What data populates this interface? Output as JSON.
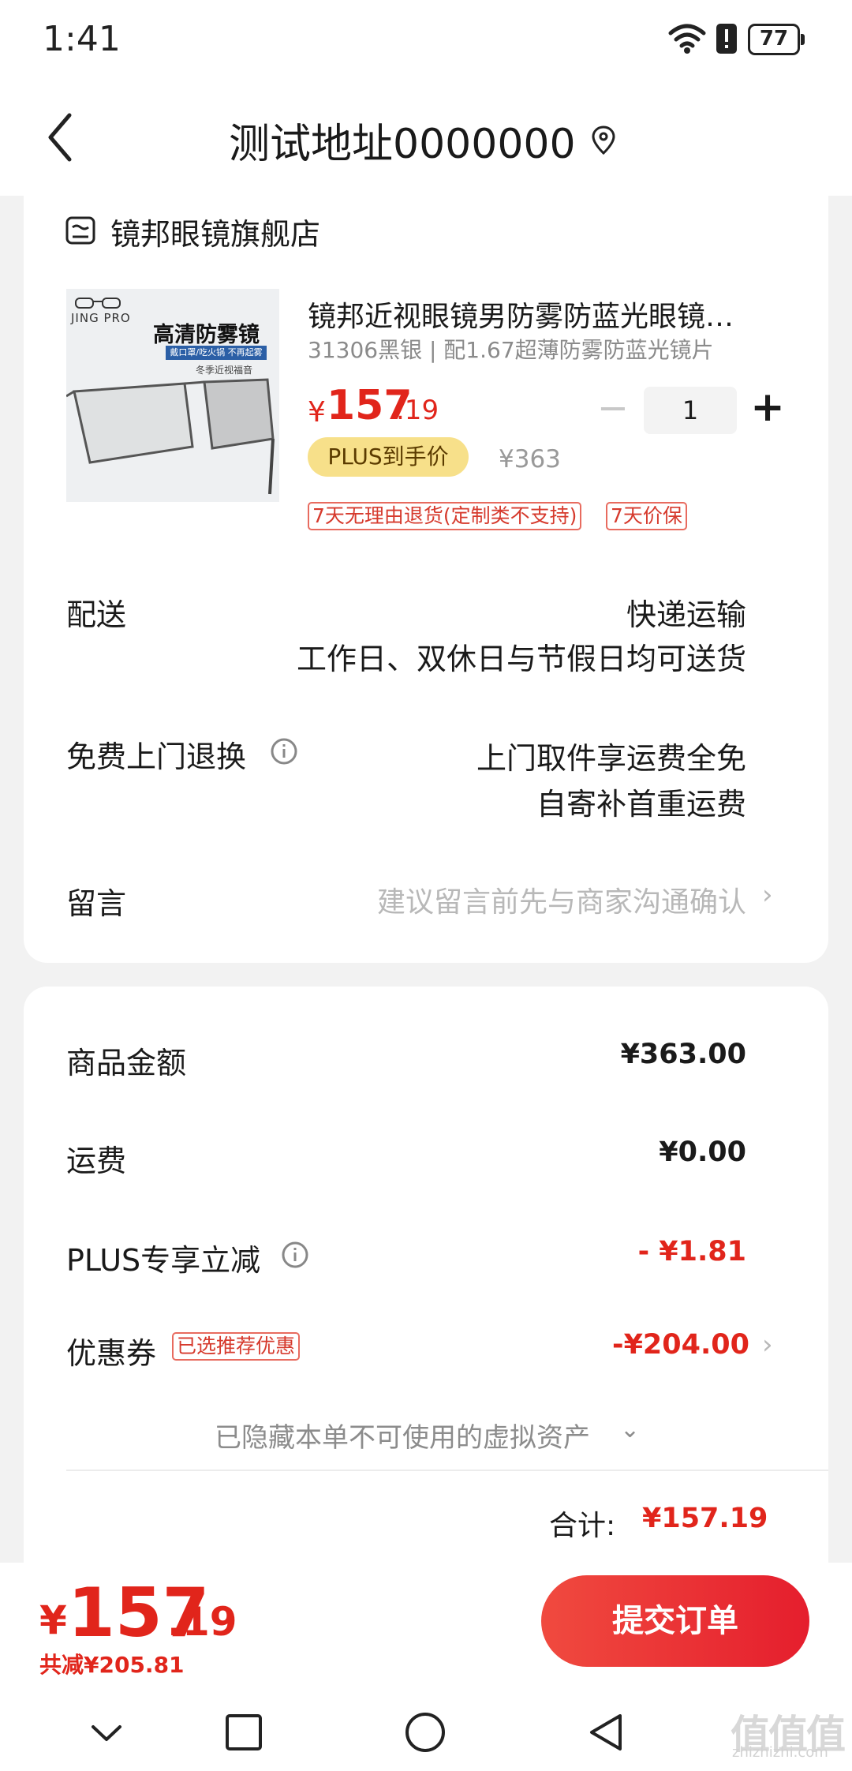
{
  "status_bar": {
    "time": "1:41",
    "battery": "77"
  },
  "header": {
    "title": "测试地址0000000"
  },
  "store": {
    "name": "镜邦眼镜旗舰店"
  },
  "product": {
    "image_text": {
      "brand": "JING PRO",
      "headline": "高清防雾镜",
      "tagbar": "戴口罩/吃火锅 不再起雾",
      "sub": "冬季近视福音"
    },
    "title": "镜邦近视眼镜男防雾防蓝光眼镜…",
    "spec": "31306黑银 | 配1.67超薄防雾防蓝光镜片",
    "price_symbol": "¥",
    "price_int": "157",
    "price_dec": ".19",
    "plus_badge": "PLUS到手价",
    "original_price": "¥363",
    "quantity": "1",
    "qty_minus": "−",
    "qty_plus": "+",
    "tags": [
      "7天无理由退货(定制类不支持)",
      "7天价保"
    ]
  },
  "delivery": {
    "label": "配送",
    "method": "快递运输",
    "note": "工作日、双休日与节假日均可送货"
  },
  "free_return": {
    "label": "免费上门退换",
    "line1": "上门取件享运费全免",
    "line2": "自寄补首重运费"
  },
  "message": {
    "label": "留言",
    "placeholder": "建议留言前先与商家沟通确认",
    "chevron": "›"
  },
  "summary": {
    "goods_label": "商品金额",
    "goods_value": "¥363.00",
    "shipping_label": "运费",
    "shipping_value": "¥0.00",
    "plus_off_label": "PLUS专享立减",
    "plus_off_value": "- ¥1.81",
    "coupon_label": "优惠券",
    "coupon_tag": "已选推荐优惠",
    "coupon_value": "-¥204.00",
    "coupon_chevron": "›",
    "hidden_assets": "已隐藏本单不可使用的虚拟资产",
    "hidden_chevron": "⌄",
    "total_label": "合计:",
    "total_value": "¥157.19"
  },
  "footer": {
    "pay_symbol": "¥",
    "pay_int": "157",
    "pay_dec": ".19",
    "saved": "共减¥205.81",
    "submit_label": "提交订单"
  },
  "watermark": {
    "glyphs": "值值值",
    "url": "zhizhizhi.com"
  },
  "colors": {
    "accent": "#e1251b",
    "plus_gold": "#f7e08a",
    "muted": "#8a8a8a"
  },
  "icons": [
    "wifi-icon",
    "alert-icon",
    "battery-icon",
    "back-icon",
    "location-pin-icon",
    "store-icon",
    "info-icon",
    "chevron-right-icon",
    "chevron-down-icon",
    "nav-down-icon",
    "nav-recent-icon",
    "nav-home-icon",
    "nav-back-icon"
  ]
}
